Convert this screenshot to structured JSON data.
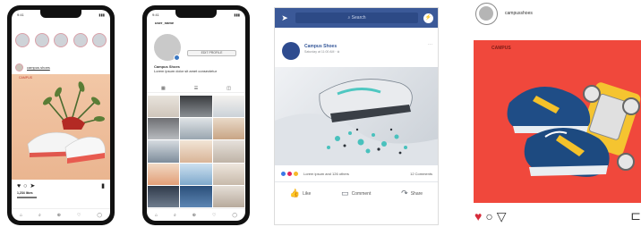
{
  "phone1": {
    "status_time": "9:41",
    "status_icons": "▮▮▮",
    "post_user": "campus shoes",
    "post_tag": "CAMPUS",
    "likes": "1,234 likes",
    "tabs": [
      "⌂",
      "⌕",
      "⊕",
      "♡",
      "◯"
    ]
  },
  "phone2": {
    "status_time": "9:41",
    "status_icons": "▮▮▮",
    "handle": "user_name",
    "edit_button": "EDIT PROFILE",
    "bio_line1": "Campus Shoes",
    "bio_line2": "Lorem ipsum dolor sit amet consectetur",
    "tabs": [
      "▦",
      "☰",
      "◫"
    ],
    "tabbar": [
      "⌂",
      "⌕",
      "⊕",
      "♡",
      "◯"
    ]
  },
  "facebook": {
    "search_placeholder": "Search",
    "page_name": "Campus Shoes",
    "time": "Saturday at 11:00 AM · ⊛",
    "more": "···",
    "reactions_text": "Lorem ipsum and 126 others",
    "comments": "12 Comments",
    "actions": [
      "Like",
      "Comment",
      "Share"
    ],
    "colors": {
      "brand": "#3b5998"
    }
  },
  "instagram": {
    "username": "campusshoes",
    "post_tag": "CAMPUS",
    "colors": {
      "like": "#d62b3a",
      "post_bg": "#f0483c"
    }
  }
}
